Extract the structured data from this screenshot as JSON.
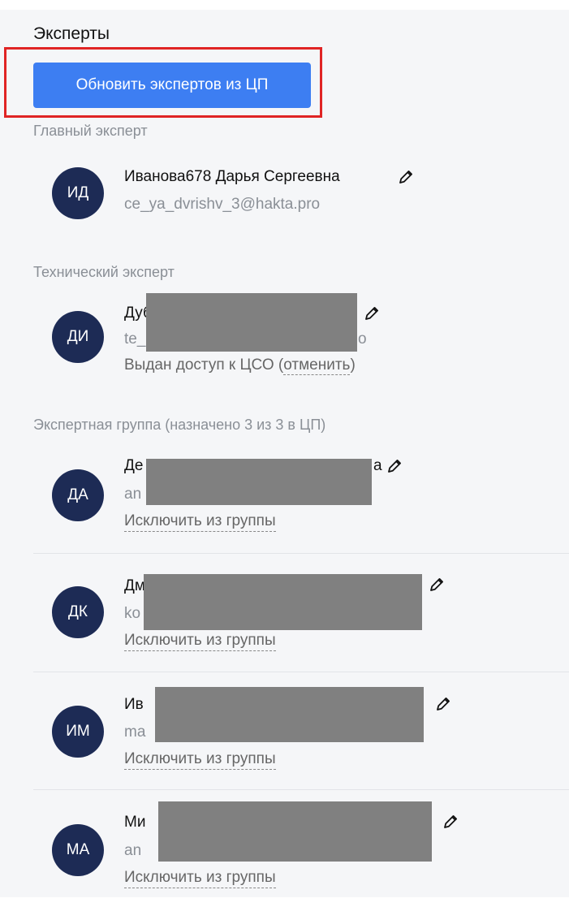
{
  "section_title": "Эксперты",
  "update_button_label": "Обновить экспертов из ЦП",
  "chief": {
    "label": "Главный эксперт",
    "initials": "ИД",
    "name": "Иванова678 Дарья Сергеевна",
    "email": "ce_ya_dvrishv_3@hakta.pro"
  },
  "technical": {
    "label": "Технический эксперт",
    "initials": "ДИ",
    "name_visible": "Дуб",
    "email_visible": "te_",
    "email_tail": "о",
    "access_text": "Выдан доступ к ЦСО (",
    "revoke_link": "отменить",
    "access_close": ")"
  },
  "group": {
    "label": "Экспертная группа (назначено 3 из 3 в ЦП)",
    "exclude_label": "Исключить из группы",
    "members": [
      {
        "initials": "ДА",
        "name_visible": "Де",
        "name_tail": "а",
        "email_visible": "an"
      },
      {
        "initials": "ДК",
        "name_visible": "Дм",
        "email_visible": "ko"
      },
      {
        "initials": "ИМ",
        "name_visible": "Ив",
        "email_visible": "ma"
      },
      {
        "initials": "МА",
        "name_visible": "Ми",
        "email_visible": "an"
      }
    ]
  },
  "icons": {
    "edit": "pencil-icon"
  },
  "colors": {
    "primary": "#3d7ef2",
    "avatar": "#1d2b55",
    "highlight": "#e02424",
    "redaction": "#808080"
  }
}
